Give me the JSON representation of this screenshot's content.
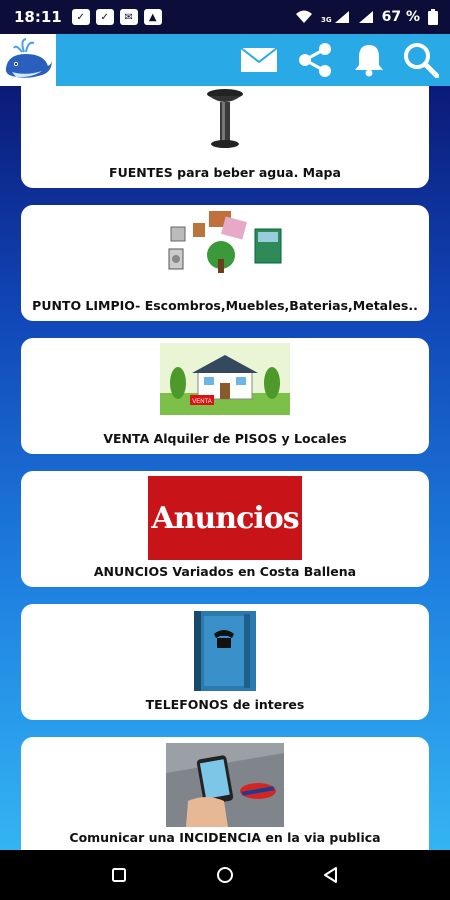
{
  "status_bar": {
    "time": "18:11",
    "battery": "67 %",
    "signal_label": "3G"
  },
  "app_bar": {
    "icons": [
      "mail-icon",
      "share-icon",
      "bell-icon",
      "search-icon"
    ],
    "accent_color": "#29a9e6"
  },
  "cards": [
    {
      "label": "FUENTES para beber agua. Mapa",
      "image": "water-fountain"
    },
    {
      "label": "PUNTO LIMPIO- Escombros,Muebles,Baterias,Metales..",
      "image": "recycling-items"
    },
    {
      "label": "VENTA Alquiler de PISOS y Locales",
      "image": "house-for-sale",
      "sign_text": "VENTA"
    },
    {
      "label": "ANUNCIOS Variados en Costa Ballena",
      "image": "anuncios-banner",
      "banner_text": "Anuncios"
    },
    {
      "label": "TELEFONOS de interes",
      "image": "phone-book"
    },
    {
      "label": "Comunicar una INCIDENCIA en la via publica",
      "image": "phone-photo-street"
    }
  ]
}
